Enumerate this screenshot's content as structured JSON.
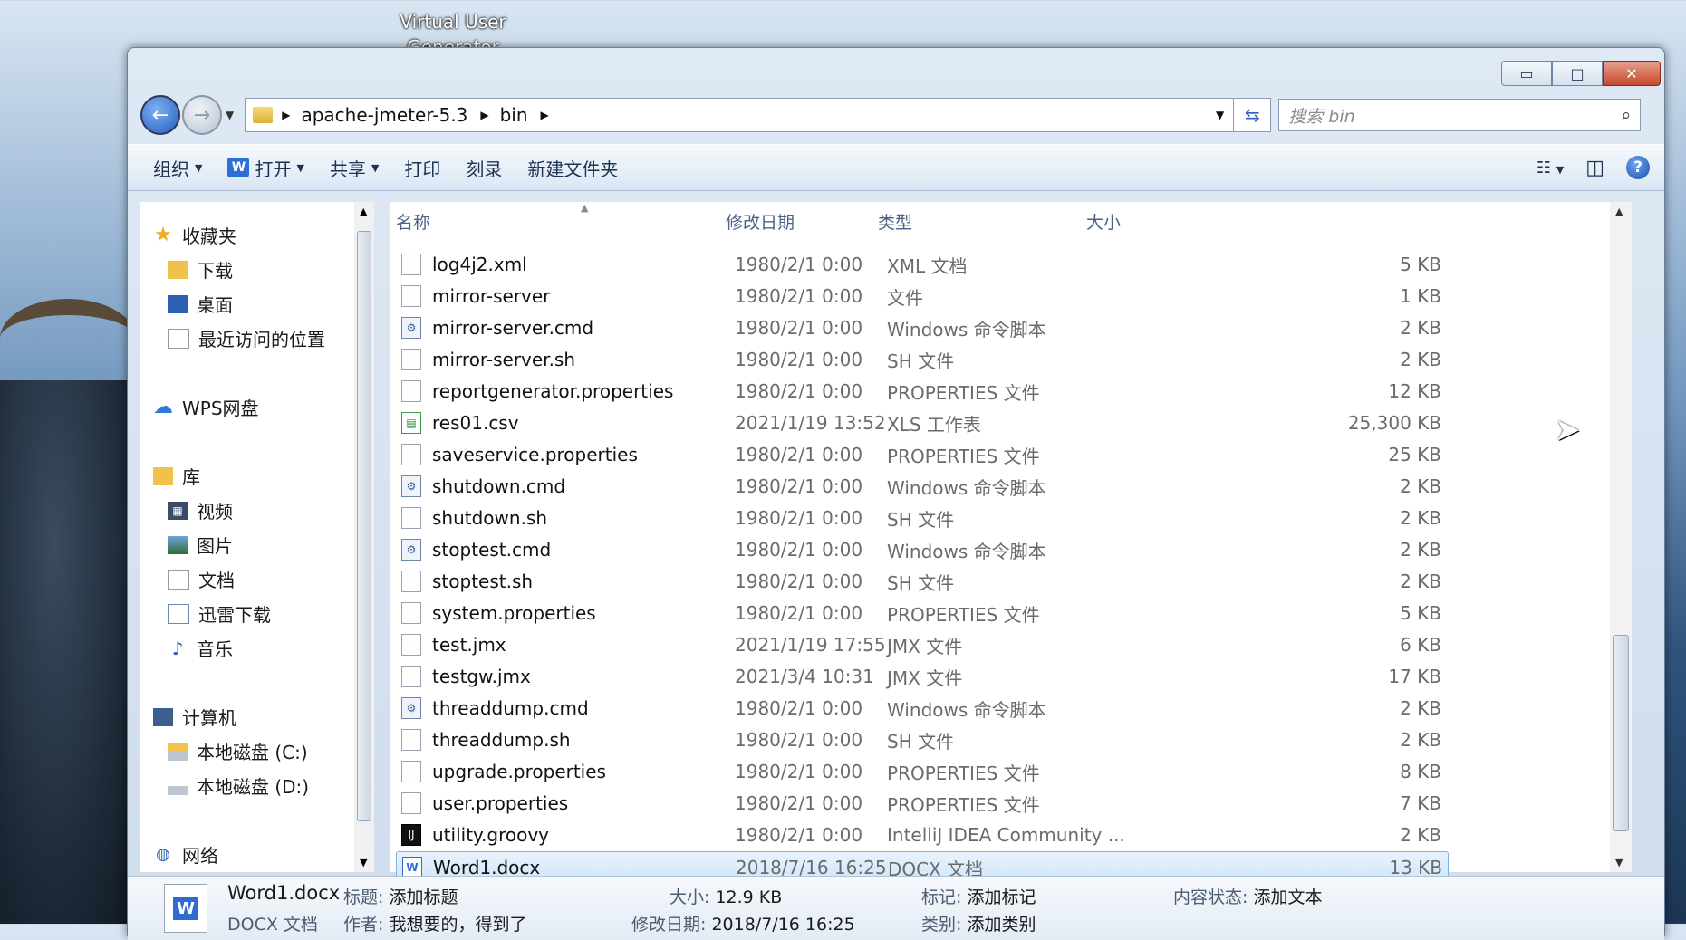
{
  "desktop": {
    "icon_label": "Virtual User Generator"
  },
  "window": {
    "controls": {
      "minimize": "▭",
      "maximize": "□",
      "close": "✕"
    },
    "breadcrumb": [
      "apache-jmeter-5.3",
      "bin"
    ],
    "search_placeholder": "搜索 bin"
  },
  "toolbar": {
    "organize": "组织",
    "open": "打开",
    "open_badge": "W",
    "share": "共享",
    "print": "打印",
    "burn": "刻录",
    "new_folder": "新建文件夹",
    "help": "?"
  },
  "navpane": {
    "favorites": "收藏夹",
    "downloads": "下载",
    "desktop": "桌面",
    "recent": "最近访问的位置",
    "wps": "WPS网盘",
    "libraries": "库",
    "video": "视频",
    "pictures": "图片",
    "documents": "文档",
    "thunder": "迅雷下载",
    "music": "音乐",
    "computer": "计算机",
    "drive_c": "本地磁盘 (C:)",
    "drive_d": "本地磁盘 (D:)",
    "network": "网络"
  },
  "columns": {
    "name": "名称",
    "date": "修改日期",
    "type": "类型",
    "size": "大小"
  },
  "files": [
    {
      "name": "log4j2.xml",
      "date": "1980/2/1 0:00",
      "type": "XML 文档",
      "size": "5 KB",
      "icon": "file"
    },
    {
      "name": "mirror-server",
      "date": "1980/2/1 0:00",
      "type": "文件",
      "size": "1 KB",
      "icon": "file"
    },
    {
      "name": "mirror-server.cmd",
      "date": "1980/2/1 0:00",
      "type": "Windows 命令脚本",
      "size": "2 KB",
      "icon": "cmd"
    },
    {
      "name": "mirror-server.sh",
      "date": "1980/2/1 0:00",
      "type": "SH 文件",
      "size": "2 KB",
      "icon": "file"
    },
    {
      "name": "reportgenerator.properties",
      "date": "1980/2/1 0:00",
      "type": "PROPERTIES 文件",
      "size": "12 KB",
      "icon": "file"
    },
    {
      "name": "res01.csv",
      "date": "2021/1/19 13:52",
      "type": "XLS 工作表",
      "size": "25,300 KB",
      "icon": "xls"
    },
    {
      "name": "saveservice.properties",
      "date": "1980/2/1 0:00",
      "type": "PROPERTIES 文件",
      "size": "25 KB",
      "icon": "file"
    },
    {
      "name": "shutdown.cmd",
      "date": "1980/2/1 0:00",
      "type": "Windows 命令脚本",
      "size": "2 KB",
      "icon": "cmd"
    },
    {
      "name": "shutdown.sh",
      "date": "1980/2/1 0:00",
      "type": "SH 文件",
      "size": "2 KB",
      "icon": "file"
    },
    {
      "name": "stoptest.cmd",
      "date": "1980/2/1 0:00",
      "type": "Windows 命令脚本",
      "size": "2 KB",
      "icon": "cmd"
    },
    {
      "name": "stoptest.sh",
      "date": "1980/2/1 0:00",
      "type": "SH 文件",
      "size": "2 KB",
      "icon": "file"
    },
    {
      "name": "system.properties",
      "date": "1980/2/1 0:00",
      "type": "PROPERTIES 文件",
      "size": "5 KB",
      "icon": "file"
    },
    {
      "name": "test.jmx",
      "date": "2021/1/19 17:55",
      "type": "JMX 文件",
      "size": "6 KB",
      "icon": "file"
    },
    {
      "name": "testgw.jmx",
      "date": "2021/3/4 10:31",
      "type": "JMX 文件",
      "size": "17 KB",
      "icon": "file"
    },
    {
      "name": "threaddump.cmd",
      "date": "1980/2/1 0:00",
      "type": "Windows 命令脚本",
      "size": "2 KB",
      "icon": "cmd"
    },
    {
      "name": "threaddump.sh",
      "date": "1980/2/1 0:00",
      "type": "SH 文件",
      "size": "2 KB",
      "icon": "file"
    },
    {
      "name": "upgrade.properties",
      "date": "1980/2/1 0:00",
      "type": "PROPERTIES 文件",
      "size": "8 KB",
      "icon": "file"
    },
    {
      "name": "user.properties",
      "date": "1980/2/1 0:00",
      "type": "PROPERTIES 文件",
      "size": "7 KB",
      "icon": "file"
    },
    {
      "name": "utility.groovy",
      "date": "1980/2/1 0:00",
      "type": "IntelliJ IDEA Community ...",
      "size": "2 KB",
      "icon": "groovy"
    },
    {
      "name": "Word1.docx",
      "date": "2018/7/16 16:25",
      "type": "DOCX 文档",
      "size": "13 KB",
      "icon": "word",
      "selected": true
    }
  ],
  "details": {
    "filename": "Word1.docx",
    "filetype": "DOCX 文档",
    "title_label": "标题:",
    "title_value": "添加标题",
    "author_label": "作者:",
    "author_value": "我想要的，得到了",
    "size_label": "大小:",
    "size_value": "12.9 KB",
    "modified_label": "修改日期:",
    "modified_value": "2018/7/16 16:25",
    "tags_label": "标记:",
    "tags_value": "添加标记",
    "category_label": "类别:",
    "category_value": "添加类别",
    "content_status_label": "内容状态:",
    "content_status_value": "添加文本"
  }
}
